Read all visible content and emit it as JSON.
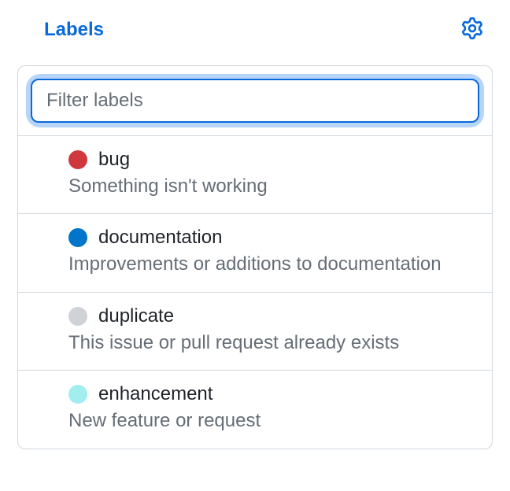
{
  "header": {
    "title": "Labels"
  },
  "filter": {
    "placeholder": "Filter labels",
    "value": ""
  },
  "labels": [
    {
      "name": "bug",
      "description": "Something isn't working",
      "color": "#d1383d"
    },
    {
      "name": "documentation",
      "description": "Improvements or additions to documentation",
      "color": "#0075ca"
    },
    {
      "name": "duplicate",
      "description": "This issue or pull request already exists",
      "color": "#cfd3d7"
    },
    {
      "name": "enhancement",
      "description": "New feature or request",
      "color": "#a2eeef"
    }
  ]
}
